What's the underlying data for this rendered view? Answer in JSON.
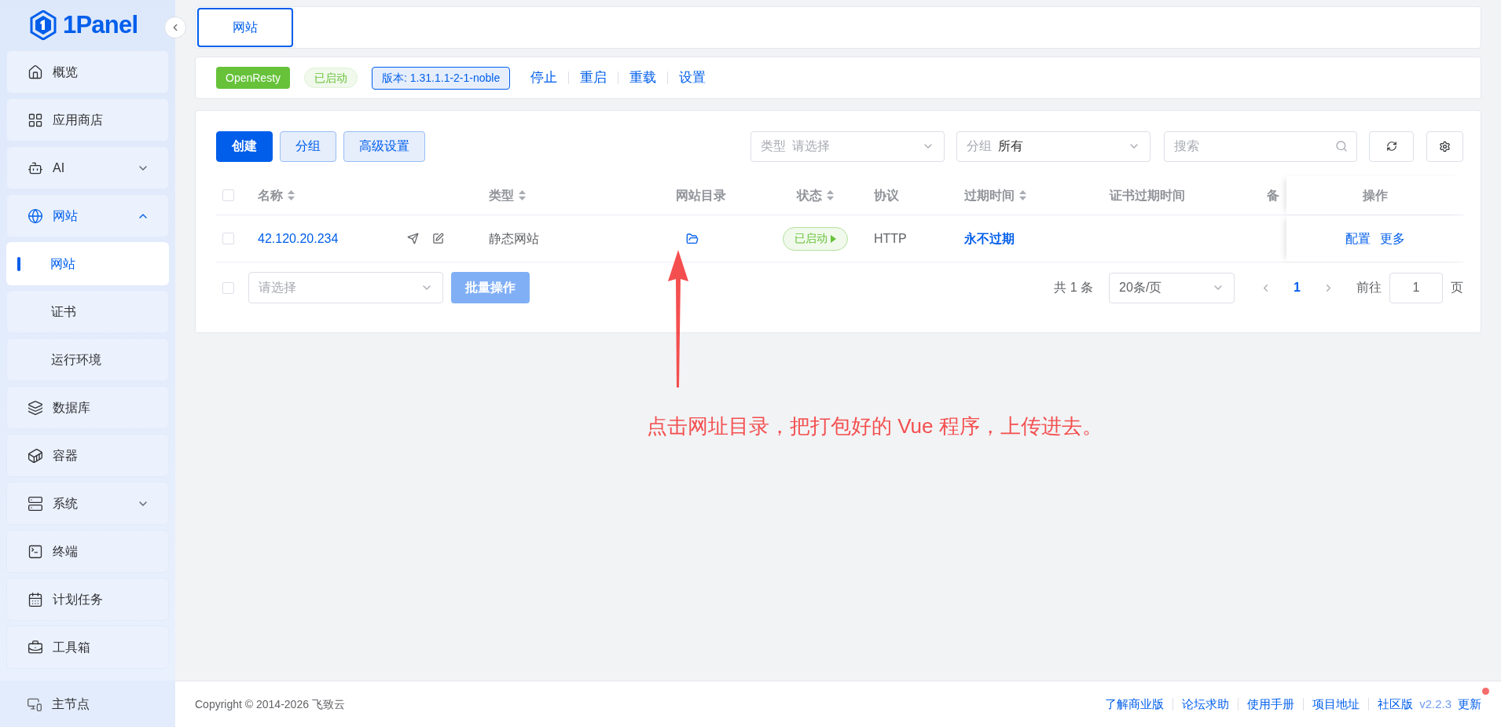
{
  "logo": {
    "text": "1Panel"
  },
  "sidebar": {
    "items": [
      {
        "label": "概览",
        "kind": "item",
        "selected": false
      },
      {
        "label": "应用商店",
        "kind": "item",
        "selected": false
      },
      {
        "label": "AI",
        "kind": "group",
        "selected": false,
        "expanded": false
      },
      {
        "label": "网站",
        "kind": "group",
        "selected": true,
        "expanded": true,
        "children": [
          {
            "label": "网站",
            "selected": true
          },
          {
            "label": "证书",
            "selected": false
          },
          {
            "label": "运行环境",
            "selected": false
          }
        ]
      },
      {
        "label": "数据库",
        "kind": "item",
        "selected": false
      },
      {
        "label": "容器",
        "kind": "item",
        "selected": false
      },
      {
        "label": "系统",
        "kind": "group",
        "selected": false,
        "expanded": false
      },
      {
        "label": "终端",
        "kind": "item",
        "selected": false
      },
      {
        "label": "计划任务",
        "kind": "item",
        "selected": false
      },
      {
        "label": "工具箱",
        "kind": "item",
        "selected": false
      }
    ],
    "node": {
      "label": "主节点"
    }
  },
  "tabs": [
    {
      "label": "网站",
      "selected": true
    }
  ],
  "server_bar": {
    "app": "OpenResty",
    "status": "已启动",
    "version": "版本: 1.31.1.1-2-1-noble",
    "actions": [
      "停止",
      "重启",
      "重载",
      "设置"
    ]
  },
  "toolbar": {
    "buttons": [
      {
        "label": "创建",
        "kind": "primary"
      },
      {
        "label": "分组",
        "kind": "plain"
      },
      {
        "label": "高级设置",
        "kind": "plain"
      }
    ],
    "filters": [
      {
        "label": "类型",
        "placeholder": "请选择"
      },
      {
        "label": "分组",
        "value": "所有"
      }
    ],
    "search": {
      "placeholder": "搜索"
    }
  },
  "table": {
    "header_checked": false,
    "columns": [
      {
        "label": "名称",
        "sortable": true
      },
      {
        "label": "类型",
        "sortable": true
      },
      {
        "label": "网站目录",
        "sortable": false
      },
      {
        "label": "状态",
        "sortable": true
      },
      {
        "label": "协议",
        "sortable": false
      },
      {
        "label": "过期时间",
        "sortable": true
      },
      {
        "label": "证书过期时间",
        "sortable": false
      },
      {
        "label": "备"
      },
      {
        "label": "操作",
        "sortable": false
      }
    ],
    "rows": [
      {
        "checked": false,
        "name": "42.120.20.234",
        "type": "静态网站",
        "status": "已启动",
        "protocol": "HTTP",
        "expires": "永不过期",
        "actions": [
          "配置",
          "更多"
        ]
      }
    ]
  },
  "batch": {
    "checked": false,
    "placeholder": "请选择",
    "button": "批量操作",
    "disabled": true
  },
  "pagination": {
    "total": "共 1 条",
    "page_size": "20条/页",
    "pages": [
      {
        "label": "1",
        "selected": true
      }
    ],
    "goto_label": "前往",
    "goto_value": "1",
    "page_suffix": "页"
  },
  "annotation": {
    "text": "点击网址目录，把打包好的 Vue 程序，上传进去。"
  },
  "footer": {
    "copyright": "Copyright © 2014-2026 飞致云",
    "links": [
      "了解商业版",
      "论坛求助",
      "使用手册",
      "项目地址",
      "社区版"
    ],
    "version": "v2.2.3",
    "update": "更新",
    "update_badge": true
  }
}
